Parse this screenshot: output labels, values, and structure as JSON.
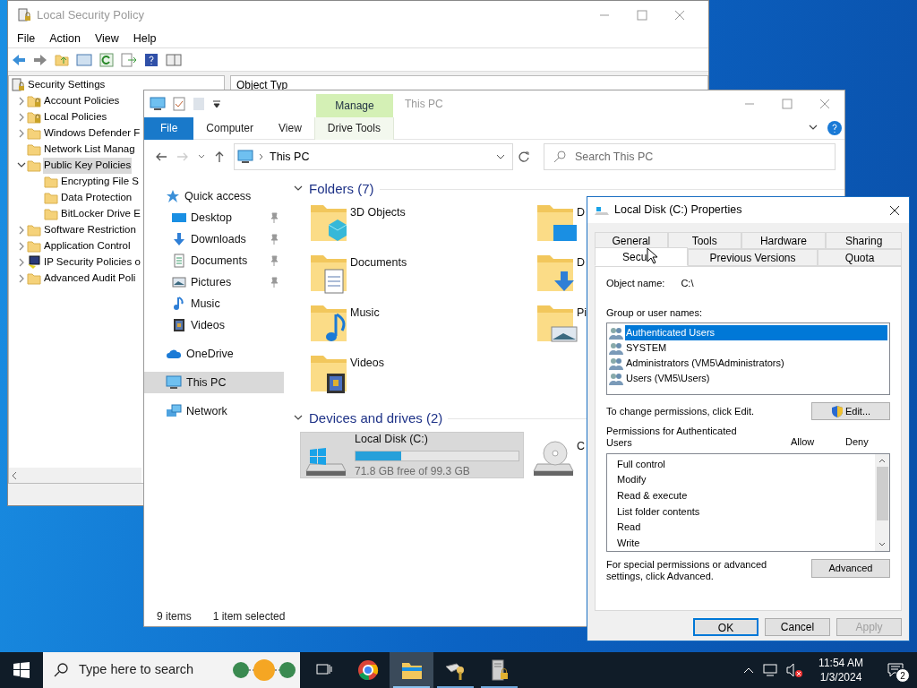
{
  "policy_window": {
    "title": "Local Security Policy",
    "menu": [
      "File",
      "Action",
      "View",
      "Help"
    ],
    "tree": {
      "label": "Security Settings",
      "kind": "root",
      "selected": false,
      "children": [
        {
          "label": "Account Policies",
          "kind": "locked",
          "expanded": false,
          "selected": false
        },
        {
          "label": "Local Policies",
          "kind": "locked",
          "expanded": false,
          "selected": false
        },
        {
          "label": "Windows Defender F",
          "kind": "folder",
          "expanded": false,
          "selected": false
        },
        {
          "label": "Network List Manag",
          "kind": "folder",
          "selected": false
        },
        {
          "label": "Public Key Policies",
          "kind": "folder",
          "expanded": true,
          "selected": true,
          "children": [
            {
              "label": "Encrypting File S",
              "kind": "folder",
              "selected": false
            },
            {
              "label": "Data Protection",
              "kind": "folder",
              "selected": false
            },
            {
              "label": "BitLocker Drive E",
              "kind": "folder",
              "selected": false
            }
          ]
        },
        {
          "label": "Software Restriction",
          "kind": "folder",
          "expanded": false,
          "selected": false
        },
        {
          "label": "Application Control",
          "kind": "folder",
          "expanded": false,
          "selected": false
        },
        {
          "label": "IP Security Policies o",
          "kind": "ipsec",
          "expanded": false,
          "selected": false
        },
        {
          "label": "Advanced Audit Poli",
          "kind": "folder",
          "expanded": false,
          "selected": false
        }
      ]
    },
    "column_1": "Object Typ"
  },
  "explorer": {
    "title": "This PC",
    "context_tab": "Manage",
    "tabs": [
      {
        "label": "File",
        "kind": "file"
      },
      {
        "label": "Computer",
        "kind": "normal"
      },
      {
        "label": "View",
        "kind": "normal"
      },
      {
        "label": "Drive Tools",
        "kind": "context"
      }
    ],
    "address": "This PC",
    "search": {
      "placeholder": "Search This PC"
    },
    "nav": [
      {
        "label": "Quick access",
        "kind": "star",
        "selected": false,
        "children": [
          {
            "label": "Desktop",
            "kind": "desktop",
            "pinned": true,
            "selected": false
          },
          {
            "label": "Downloads",
            "kind": "downloads",
            "pinned": true,
            "selected": false
          },
          {
            "label": "Documents",
            "kind": "documents",
            "pinned": true,
            "selected": false
          },
          {
            "label": "Pictures",
            "kind": "pictures",
            "pinned": true,
            "selected": false
          },
          {
            "label": "Music",
            "kind": "music",
            "pinned": false,
            "selected": false
          },
          {
            "label": "Videos",
            "kind": "videos",
            "pinned": false,
            "selected": false
          }
        ]
      },
      {
        "label": "OneDrive",
        "kind": "cloud",
        "selected": false
      },
      {
        "label": "This PC",
        "kind": "pc",
        "selected": true
      },
      {
        "label": "Network",
        "kind": "network",
        "selected": false
      }
    ],
    "folders_header": "Folders (7)",
    "folders": [
      {
        "label": "3D Objects",
        "kind": "cube"
      },
      {
        "label": "D",
        "kind": "desktop"
      },
      {
        "label": "Documents",
        "kind": "documents"
      },
      {
        "label": "D",
        "kind": "downloads"
      },
      {
        "label": "Music",
        "kind": "music"
      },
      {
        "label": "Pi",
        "kind": "pictures"
      },
      {
        "label": "Videos",
        "kind": "videos"
      }
    ],
    "drives_header": "Devices and drives (2)",
    "drives": [
      {
        "label": "Local Disk (C:)",
        "kind": "system",
        "selected": true,
        "level": 0.28,
        "free": "71.8 GB free of 99.3 GB"
      },
      {
        "label": "C",
        "kind": "optical",
        "selected": false
      }
    ],
    "status": [
      "9 items",
      "1 item selected"
    ]
  },
  "dialog": {
    "title": "Local Disk (C:) Properties",
    "tabs": [
      {
        "label": "General",
        "selected": false
      },
      {
        "label": "Tools",
        "selected": false
      },
      {
        "label": "Hardware",
        "selected": false
      },
      {
        "label": "Sharing",
        "selected": false
      },
      {
        "label": "Secu",
        "selected": true
      },
      {
        "label": "Previous Versions",
        "selected": false
      },
      {
        "label": "Quota",
        "selected": false
      }
    ],
    "object_label": "Object name:",
    "object_value": "C:\\",
    "groups_label": "Group or user names:",
    "groups": [
      {
        "label": "Authenticated Users",
        "selected": true
      },
      {
        "label": "SYSTEM",
        "selected": false
      },
      {
        "label": "Administrators (VM5\\Administrators)",
        "selected": false
      },
      {
        "label": "Users (VM5\\Users)",
        "selected": false
      }
    ],
    "change_text": "To change permissions, click Edit.",
    "edit_button": "Edit...",
    "permissions_label": "Permissions for Authenticated Users",
    "allow": "Allow",
    "deny": "Deny",
    "permissions": [
      "Full control",
      "Modify",
      "Read & execute",
      "List folder contents",
      "Read",
      "Write"
    ],
    "advanced_text": "For special permissions or advanced settings, click Advanced.",
    "advanced_button": "Advanced",
    "buttons": [
      {
        "label": "OK",
        "kind": "default",
        "disabled": false
      },
      {
        "label": "Cancel",
        "kind": "normal",
        "disabled": false
      },
      {
        "label": "Apply",
        "kind": "normal",
        "disabled": true
      }
    ]
  },
  "taskbar": {
    "search": {
      "placeholder": "Type here to search"
    },
    "apps": [
      {
        "kind": "task-view",
        "running": false,
        "active": false
      },
      {
        "kind": "browser",
        "running": false,
        "active": false
      },
      {
        "kind": "explorer",
        "running": true,
        "active": true
      },
      {
        "kind": "tool",
        "running": true,
        "active": false
      },
      {
        "kind": "server",
        "running": true,
        "active": false
      }
    ],
    "time": "11:54 AM",
    "date": "1/3/2024",
    "notifications": "2"
  }
}
